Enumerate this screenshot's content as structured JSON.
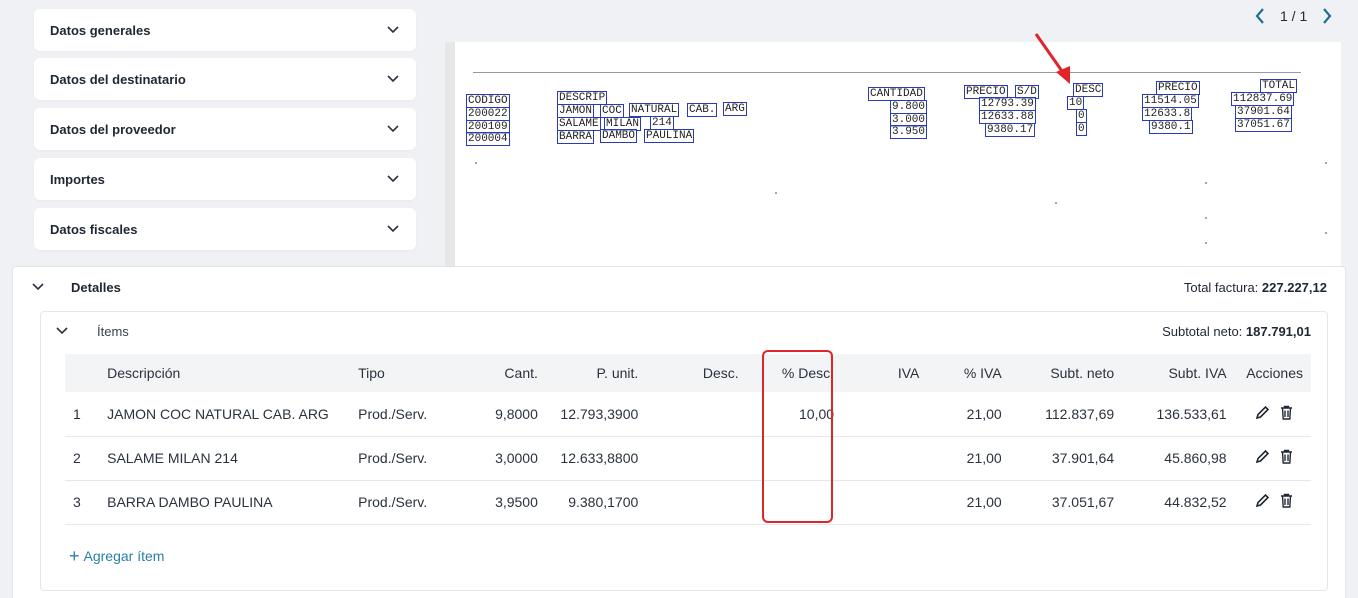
{
  "sections": [
    "Datos generales",
    "Datos del destinatario",
    "Datos del proveedor",
    "Importes",
    "Datos fiscales"
  ],
  "pager": {
    "label": "1 / 1"
  },
  "document": {
    "headers": {
      "codigo": "CODIGO",
      "descrip": "DESCRIP",
      "cantidad": "CANTIDAD",
      "precio": "PRECIO",
      "sd": "S/D",
      "desc": "DESC",
      "precio2": "PRECIO",
      "total": "TOTAL"
    },
    "rows": [
      {
        "codigo": "200022",
        "words": [
          "JAMON",
          "COC",
          "NATURAL",
          "CAB.",
          "ARG"
        ],
        "cantidad": "9.800",
        "precio": "12793.39",
        "desc": "10",
        "precio2": "11514.05",
        "total": "112837.69"
      },
      {
        "codigo": "200109",
        "words": [
          "SALAME",
          "MILAN",
          "214"
        ],
        "cantidad": "3.000",
        "precio": "12633.88",
        "desc": "0",
        "precio2": "12633.8",
        "total": "37901.64"
      },
      {
        "codigo": "200004",
        "words": [
          "BARRA",
          "DAMBO",
          "PAULINA"
        ],
        "cantidad": "3.950",
        "precio": "9380.17",
        "desc": "0",
        "precio2": "9380.1",
        "total": "37051.67"
      }
    ]
  },
  "detalles": {
    "title": "Detalles",
    "total_label": "Total factura:",
    "total_value": "227.227,12"
  },
  "items": {
    "title": "Ítems",
    "subtotal_label": "Subtotal neto:",
    "subtotal_value": "187.791,01",
    "columns": [
      "Descripción",
      "Tipo",
      "Cant.",
      "P. unit.",
      "Desc.",
      "% Desc.",
      "IVA",
      "% IVA",
      "Subt. neto",
      "Subt. IVA",
      "Acciones"
    ],
    "rows": [
      {
        "n": "1",
        "desc": "JAMON COC NATURAL CAB. ARG",
        "tipo": "Prod./Serv.",
        "cant": "9,8000",
        "punit": "12.793,3900",
        "descv": "",
        "pdesc": "10,00",
        "iva": "",
        "piva": "21,00",
        "sneto": "112.837,69",
        "siva": "136.533,61"
      },
      {
        "n": "2",
        "desc": "SALAME MILAN 214",
        "tipo": "Prod./Serv.",
        "cant": "3,0000",
        "punit": "12.633,8800",
        "descv": "",
        "pdesc": "",
        "iva": "",
        "piva": "21,00",
        "sneto": "37.901,64",
        "siva": "45.860,98"
      },
      {
        "n": "3",
        "desc": "BARRA DAMBO PAULINA",
        "tipo": "Prod./Serv.",
        "cant": "3,9500",
        "punit": "9.380,1700",
        "descv": "",
        "pdesc": "",
        "iva": "",
        "piva": "21,00",
        "sneto": "37.051,67",
        "siva": "44.832,52"
      }
    ],
    "add_label": "Agregar ítem"
  },
  "colors": {
    "accent": "#1f6f9a",
    "highlight": "#e0242a",
    "scan_box": "#2b3bb5"
  }
}
